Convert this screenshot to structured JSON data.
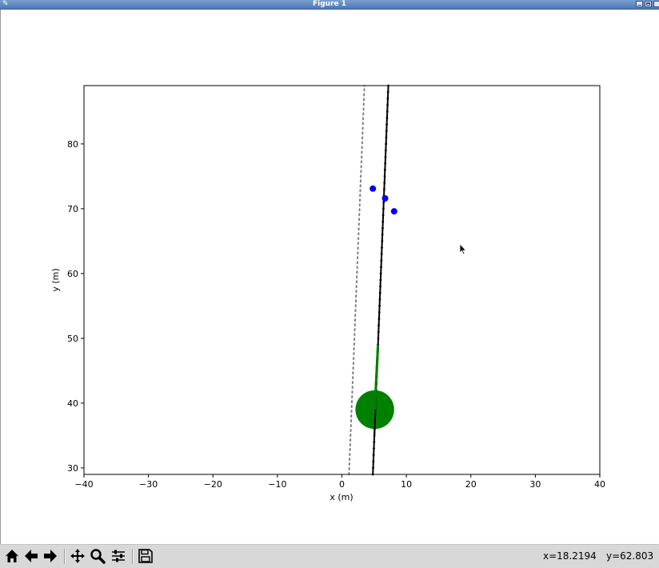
{
  "window": {
    "title": "Figure 1"
  },
  "toolbar": {
    "buttons": [
      "home-icon",
      "back-arrow-icon",
      "forward-arrow-icon",
      "pan-icon",
      "zoom-icon",
      "configure-subplots-icon",
      "save-icon"
    ],
    "x_readout": "x=18.2194",
    "y_readout": "y=62.803"
  },
  "chart_data": {
    "type": "line",
    "xlabel": "x (m)",
    "ylabel": "y (m)",
    "xlim": [
      -40,
      40
    ],
    "ylim": [
      29,
      89
    ],
    "xticks": [
      -40,
      -30,
      -20,
      -10,
      0,
      10,
      20,
      30,
      40
    ],
    "yticks": [
      30,
      40,
      50,
      60,
      70,
      80
    ],
    "grid": false,
    "series": [
      {
        "style": "dotted",
        "color": "#808080",
        "points": [
          [
            1.1,
            29
          ],
          [
            3.5,
            89
          ]
        ]
      },
      {
        "style": "solid-with-markers",
        "color": "#000000",
        "points": [
          [
            4.8,
            29
          ],
          [
            7.2,
            89
          ]
        ]
      },
      {
        "style": "solid",
        "color": "#008000",
        "points": [
          [
            5.1,
            39
          ],
          [
            5.6,
            49
          ]
        ]
      }
    ],
    "points": [
      {
        "x": 4.8,
        "y": 73.1,
        "color": "#0000ff"
      },
      {
        "x": 6.7,
        "y": 71.6,
        "color": "#0000ff"
      },
      {
        "x": 8.1,
        "y": 69.6,
        "color": "#0000ff"
      }
    ],
    "circle": {
      "x": 5.1,
      "y": 39,
      "radius": 3,
      "color": "#008000"
    }
  }
}
